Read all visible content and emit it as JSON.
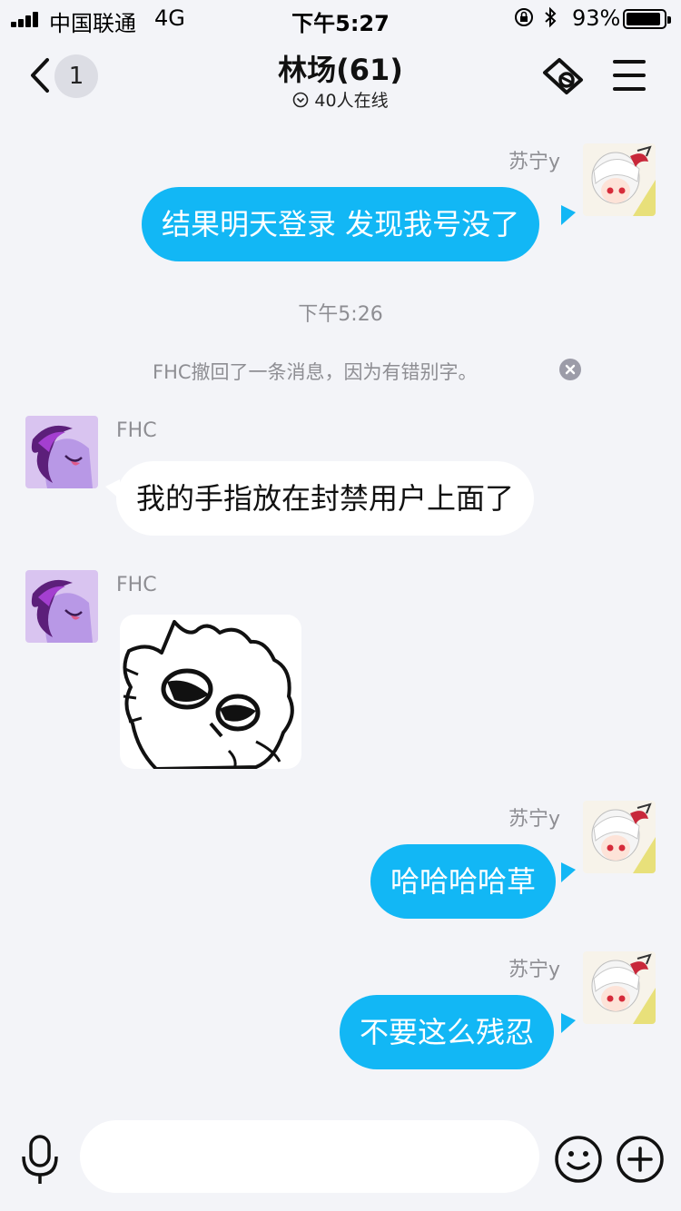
{
  "status_bar": {
    "carrier": "中国联通",
    "network": "4G",
    "time": "下午5:27",
    "battery": "93%",
    "battery_level": 0.93
  },
  "nav": {
    "back_badge": "1",
    "title": "林场(61)",
    "online_text": "40人在线"
  },
  "messages": [
    {
      "sender": "苏宁y",
      "text": "结果明天登录 发现我号没了",
      "direction": "out"
    },
    {
      "sender": "FHC",
      "text": "我的手指放在封禁用户上面了",
      "direction": "in"
    },
    {
      "sender": "FHC",
      "type": "sticker",
      "direction": "in"
    },
    {
      "sender": "苏宁y",
      "text": "哈哈哈哈草",
      "direction": "out"
    },
    {
      "sender": "苏宁y",
      "text": "不要这么残忍",
      "direction": "out"
    }
  ],
  "time_divider": "下午5:26",
  "recall_notice": "FHC撤回了一条消息，因为有错别字。",
  "colors": {
    "outgoing_bubble": "#12b7f5",
    "incoming_bubble": "#ffffff",
    "background": "#f3f4f8"
  },
  "icons": [
    "signal-icon",
    "rotation-lock-icon",
    "bluetooth-icon",
    "battery-icon",
    "back-icon",
    "ticket-icon",
    "menu-icon",
    "close-icon",
    "mic-icon",
    "emoji-icon",
    "plus-icon"
  ]
}
